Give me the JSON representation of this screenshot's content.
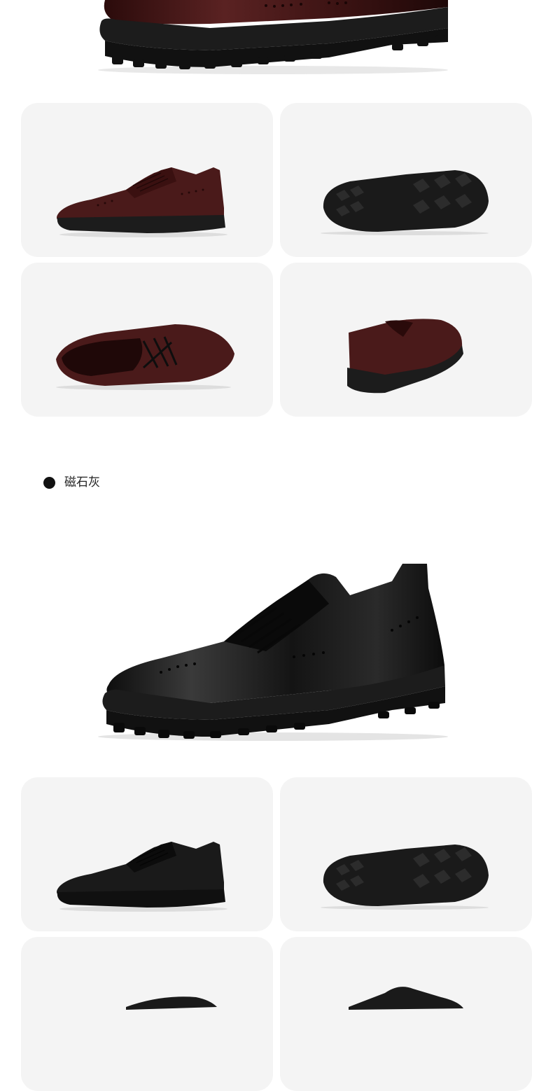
{
  "colors": {
    "burgundy": "#4a1a1a",
    "black_leather": "#161616",
    "sole": "#1c1c1c",
    "card_bg": "#f4f4f4"
  },
  "variants": [
    {
      "name": "",
      "swatch_hex": "#4a1a1a",
      "views": [
        "side",
        "sole",
        "top",
        "back"
      ]
    },
    {
      "name": "磁石灰",
      "swatch_hex": "#111111",
      "views": [
        "hero",
        "side",
        "sole",
        "top",
        "back"
      ]
    }
  ]
}
